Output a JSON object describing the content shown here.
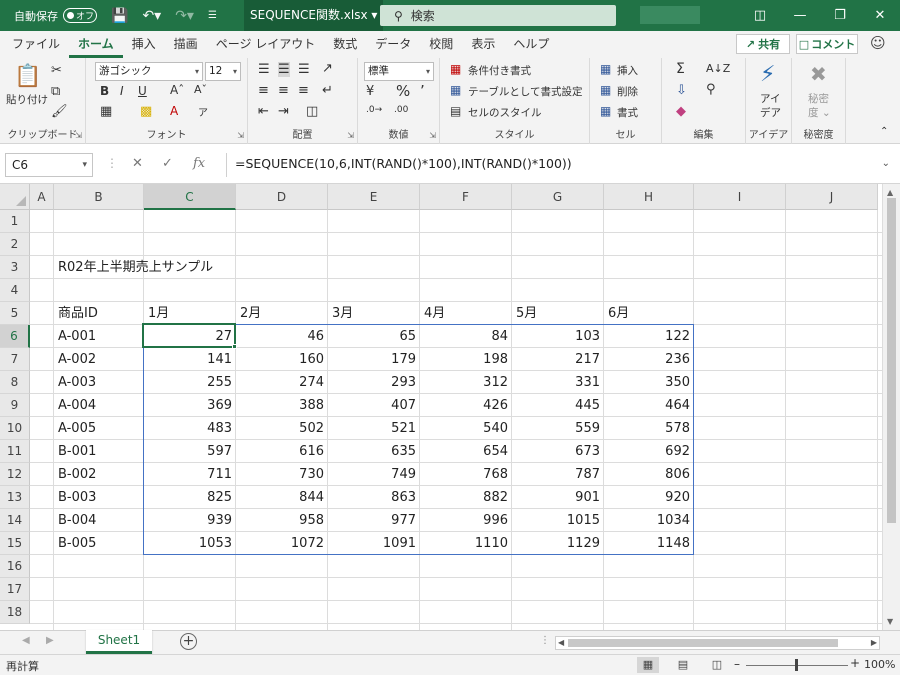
{
  "titlebar": {
    "autosave_label": "自動保存",
    "autosave_state": "オフ",
    "filename": "SEQUENCE関数.xlsx",
    "search_placeholder": "検索"
  },
  "menu": {
    "tabs": [
      "ファイル",
      "ホーム",
      "挿入",
      "描画",
      "ページ レイアウト",
      "数式",
      "データ",
      "校閲",
      "表示",
      "ヘルプ"
    ],
    "active_tab": "ホーム",
    "share_label": "共有",
    "comment_label": "コメント"
  },
  "ribbon": {
    "clipboard": {
      "label": "クリップボード",
      "paste": "貼り付け"
    },
    "font": {
      "label": "フォント",
      "font_name": "游ゴシック",
      "font_size": "12"
    },
    "alignment": {
      "label": "配置"
    },
    "number": {
      "label": "数値",
      "format": "標準"
    },
    "styles": {
      "label": "スタイル",
      "conditional": "条件付き書式",
      "table": "テーブルとして書式設定",
      "cell_styles": "セルのスタイル"
    },
    "cells": {
      "label": "セル",
      "insert": "挿入",
      "delete": "削除",
      "format": "書式"
    },
    "editing": {
      "label": "編集"
    },
    "ideas": {
      "label": "アイデア",
      "button": "アイ\nデア"
    },
    "sensitivity": {
      "label": "秘密度",
      "button": "秘密\n度"
    }
  },
  "formula_bar": {
    "name_box": "C6",
    "formula": "=SEQUENCE(10,6,INT(RAND()*100),INT(RAND()*100))"
  },
  "grid": {
    "columns": [
      "A",
      "B",
      "C",
      "D",
      "E",
      "F",
      "G",
      "H",
      "I",
      "J"
    ],
    "rows": [
      "1",
      "2",
      "3",
      "4",
      "5",
      "6",
      "7",
      "8",
      "9",
      "10",
      "11",
      "12",
      "13",
      "14",
      "15",
      "16",
      "17",
      "18"
    ],
    "selected_column": "C",
    "selected_row": "6",
    "title": "R02年上半期売上サンプル",
    "header_label": "商品ID",
    "months": [
      "1月",
      "2月",
      "3月",
      "4月",
      "5月",
      "6月"
    ],
    "ids": [
      "A-001",
      "A-002",
      "A-003",
      "A-004",
      "A-005",
      "B-001",
      "B-002",
      "B-003",
      "B-004",
      "B-005"
    ],
    "values": [
      [
        "27",
        "46",
        "65",
        "84",
        "103",
        "122"
      ],
      [
        "141",
        "160",
        "179",
        "198",
        "217",
        "236"
      ],
      [
        "255",
        "274",
        "293",
        "312",
        "331",
        "350"
      ],
      [
        "369",
        "388",
        "407",
        "426",
        "445",
        "464"
      ],
      [
        "483",
        "502",
        "521",
        "540",
        "559",
        "578"
      ],
      [
        "597",
        "616",
        "635",
        "654",
        "673",
        "692"
      ],
      [
        "711",
        "730",
        "749",
        "768",
        "787",
        "806"
      ],
      [
        "825",
        "844",
        "863",
        "882",
        "901",
        "920"
      ],
      [
        "939",
        "958",
        "977",
        "996",
        "1015",
        "1034"
      ],
      [
        "1053",
        "1072",
        "1091",
        "1110",
        "1129",
        "1148"
      ]
    ]
  },
  "sheets": {
    "active": "Sheet1"
  },
  "status": {
    "mode": "再計算",
    "zoom": "100%"
  },
  "colors": {
    "accent": "#217346",
    "spill_border": "#4472c4"
  }
}
